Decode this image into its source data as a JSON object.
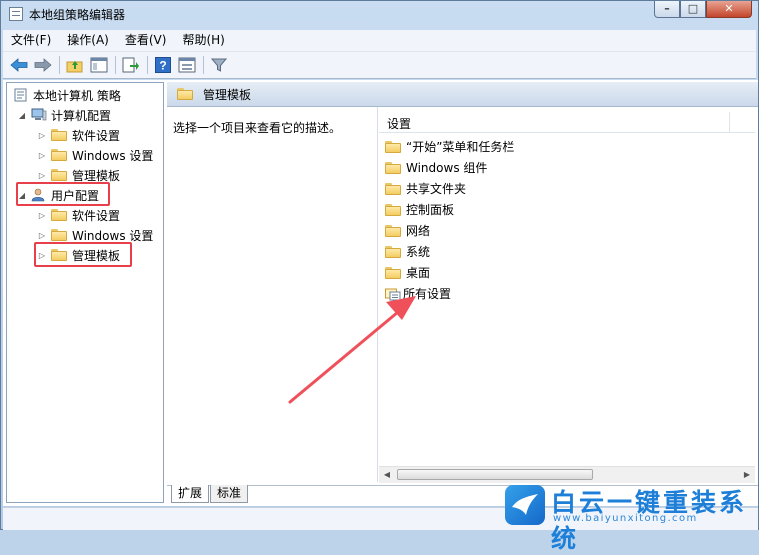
{
  "window": {
    "title": "本地组策略编辑器",
    "controls": {
      "minimize": "–",
      "maximize": "□",
      "close": "✕"
    }
  },
  "menu": [
    "文件(F)",
    "操作(A)",
    "查看(V)",
    "帮助(H)"
  ],
  "toolbar": [
    "back-icon",
    "forward-icon",
    "up-folder-icon",
    "show-hide-tree-icon",
    "export-list-icon",
    "help-icon",
    "properties-icon",
    "filter-icon"
  ],
  "tree": {
    "root": "本地计算机 策略",
    "computer": {
      "label": "计算机配置",
      "children": [
        "软件设置",
        "Windows 设置",
        "管理模板"
      ]
    },
    "user": {
      "label": "用户配置",
      "children": [
        "软件设置",
        "Windows 设置",
        "管理模板"
      ]
    }
  },
  "right": {
    "header": "管理模板",
    "description": "选择一个项目来查看它的描述。",
    "column": "设置",
    "items": [
      "“开始”菜单和任务栏",
      "Windows 组件",
      "共享文件夹",
      "控制面板",
      "网络",
      "系统",
      "桌面",
      "所有设置"
    ]
  },
  "tabs": [
    "扩展",
    "标准"
  ],
  "watermark": {
    "name": "白云一键重装系统",
    "url": "www.baiyunxitong.com"
  },
  "colors": {
    "highlight": "#e8404a",
    "accent": "#1e7fd8"
  }
}
